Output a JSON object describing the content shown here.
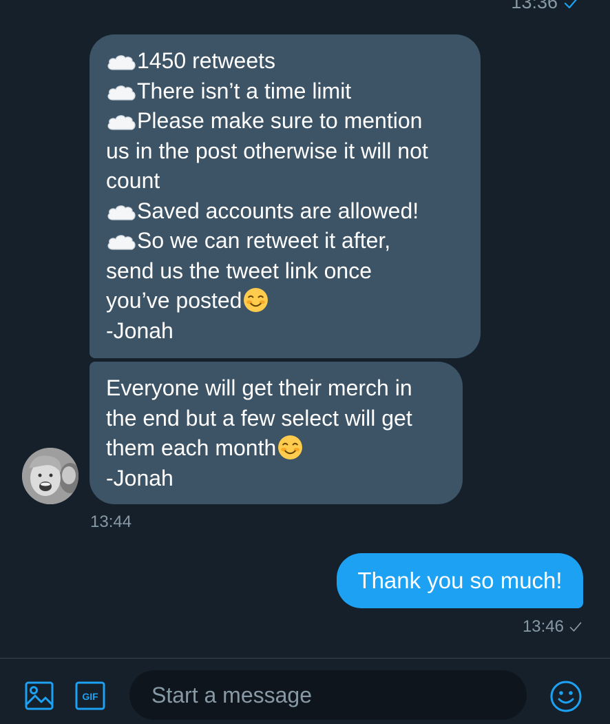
{
  "header": {
    "top_timestamp": "13:36",
    "top_status_icon": "check-icon"
  },
  "messages": [
    {
      "direction": "incoming",
      "lines": [
        {
          "icon": "cloud-icon",
          "text": "1450 retweets"
        },
        {
          "icon": "cloud-icon",
          "text": "There isn’t a time limit"
        },
        {
          "icon": "cloud-icon",
          "text": "Please make sure to mention"
        },
        {
          "icon": "",
          "text": "us in the post otherwise it will not"
        },
        {
          "icon": "",
          "text": "count"
        },
        {
          "icon": "cloud-icon",
          "text": "Saved accounts are allowed!"
        },
        {
          "icon": "cloud-icon",
          "text": "So we can retweet it after,"
        },
        {
          "icon": "",
          "text": "send us the tweet link once"
        },
        {
          "icon": "",
          "text": "you’ve posted",
          "trailing_emoji": "smiling-face-emoji"
        },
        {
          "icon": "",
          "text": "-Jonah"
        }
      ]
    },
    {
      "direction": "incoming",
      "lines": [
        {
          "text": "Everyone will get their merch in"
        },
        {
          "text": "the end but a few select will get"
        },
        {
          "text": "them each month",
          "trailing_emoji": "smiling-face-emoji"
        },
        {
          "text": "-Jonah"
        }
      ],
      "timestamp": "13:44",
      "avatar": "user-avatar"
    },
    {
      "direction": "outgoing",
      "text": "Thank you so much!",
      "timestamp": "13:46",
      "status_icon": "check-icon"
    }
  ],
  "composer": {
    "placeholder": "Start a message",
    "media_icon": "image-icon",
    "gif_icon": "gif-icon",
    "gif_label": "GIF",
    "emoji_icon": "emoji-icon"
  },
  "colors": {
    "background": "#15202b",
    "incoming_bubble": "#3d5466",
    "outgoing_bubble": "#1da1f2",
    "muted_text": "#8899a6",
    "accent": "#1da1f2"
  }
}
